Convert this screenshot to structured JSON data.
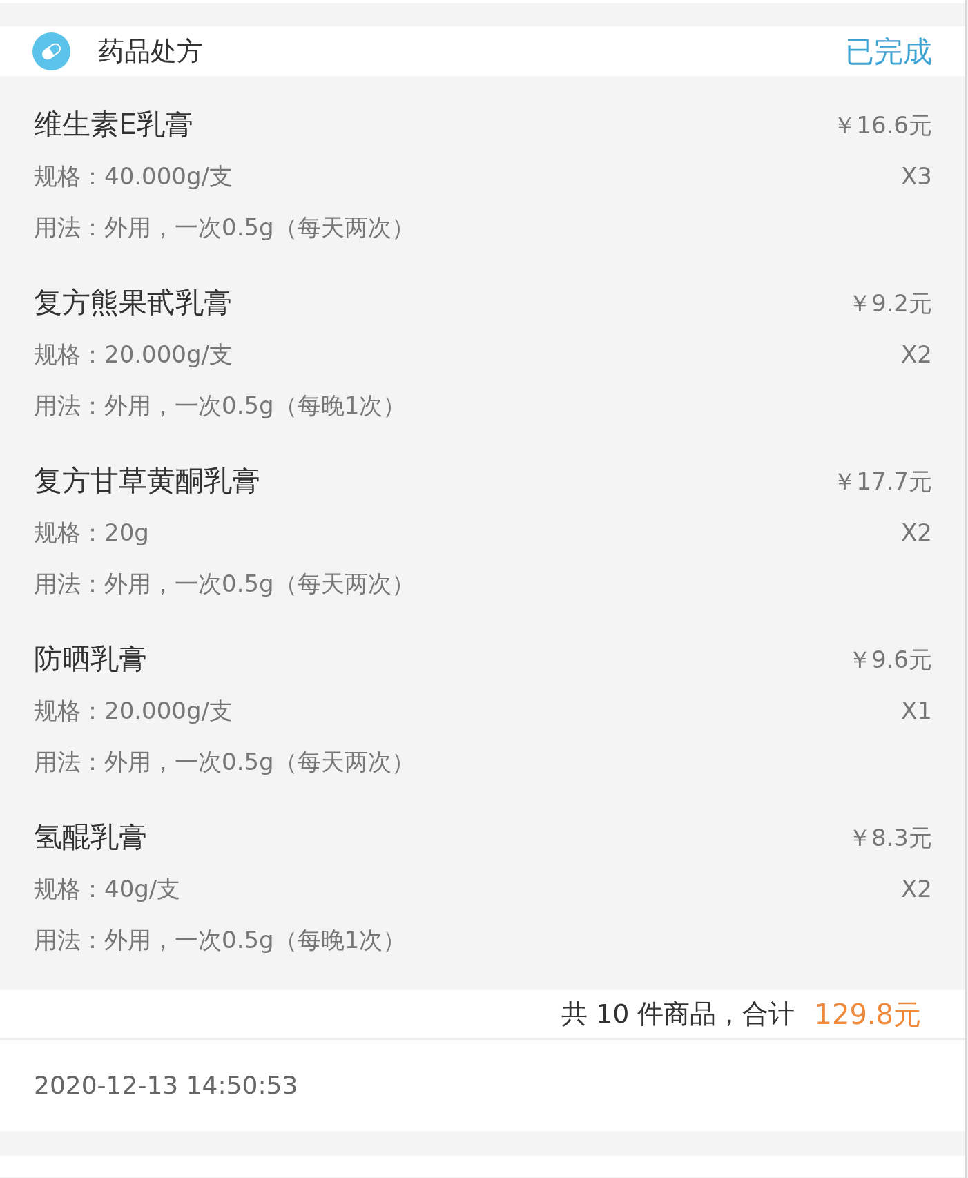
{
  "section": {
    "title": "药品处方",
    "status": "已完成"
  },
  "items": [
    {
      "name": "维生素E乳膏",
      "price": "￥16.6元",
      "spec": "规格：40.000g/支",
      "quantity": "X3",
      "usage": "用法：外用，一次0.5g（每天两次）"
    },
    {
      "name": "复方熊果甙乳膏",
      "price": "￥9.2元",
      "spec": "规格：20.000g/支",
      "quantity": "X2",
      "usage": "用法：外用，一次0.5g（每晚1次）"
    },
    {
      "name": "复方甘草黄酮乳膏",
      "price": "￥17.7元",
      "spec": "规格：20g",
      "quantity": "X2",
      "usage": "用法：外用，一次0.5g（每天两次）"
    },
    {
      "name": "防晒乳膏",
      "price": "￥9.6元",
      "spec": "规格：20.000g/支",
      "quantity": "X1",
      "usage": "用法：外用，一次0.5g（每天两次）"
    },
    {
      "name": "氢醌乳膏",
      "price": "￥8.3元",
      "spec": "规格：40g/支",
      "quantity": "X2",
      "usage": "用法：外用，一次0.5g（每晚1次）"
    }
  ],
  "summary": {
    "count_text": "共 10 件商品，合计",
    "total": "129.8元"
  },
  "order_time": "2020-12-13 14:50:53"
}
